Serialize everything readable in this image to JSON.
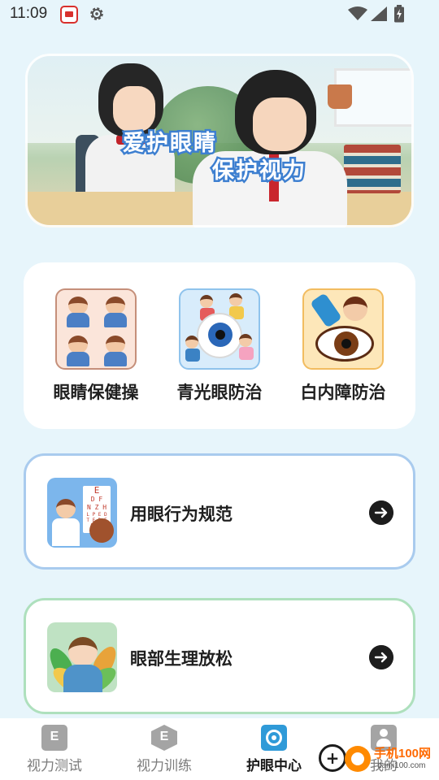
{
  "status_bar": {
    "time": "11:09",
    "icons": [
      "app-notification-icon",
      "gear-icon",
      "wifi-icon",
      "signal-icon",
      "battery-icon"
    ]
  },
  "banner": {
    "line1": "爱护眼睛",
    "line2": "保护视力",
    "text_color": "#ffffff",
    "stroke_color": "#3d7fd0"
  },
  "categories": [
    {
      "label": "眼睛保健操",
      "icon": "eye-exercise-icon"
    },
    {
      "label": "青光眼防治",
      "icon": "glaucoma-icon"
    },
    {
      "label": "白内障防治",
      "icon": "cataract-icon"
    }
  ],
  "list_cards": [
    {
      "label": "用眼行为规范",
      "icon": "eye-chart-doctor-icon",
      "border_color": "#a9cbee"
    },
    {
      "label": "眼部生理放松",
      "icon": "relaxing-child-icon",
      "border_color": "#aee0bd"
    }
  ],
  "eye_chart_letters": [
    "E",
    "D F",
    "N Z H",
    "L P E D",
    "T E D F",
    "O C P"
  ],
  "bottom_nav": {
    "items": [
      {
        "label": "视力测试",
        "icon": "vision-test-icon",
        "glyph": "E",
        "active": false
      },
      {
        "label": "视力训练",
        "icon": "vision-training-icon",
        "glyph": "E",
        "active": false
      },
      {
        "label": "护眼中心",
        "icon": "eye-care-center-icon",
        "active": true
      },
      {
        "label": "我的",
        "icon": "profile-icon",
        "active": false
      }
    ],
    "active_color": "#2f9ad8",
    "inactive_color": "#a4a4a4"
  },
  "watermark": {
    "text": "手机100网",
    "url": "danji100.com"
  },
  "colors": {
    "background": "#e7f5fb",
    "card": "#ffffff"
  }
}
